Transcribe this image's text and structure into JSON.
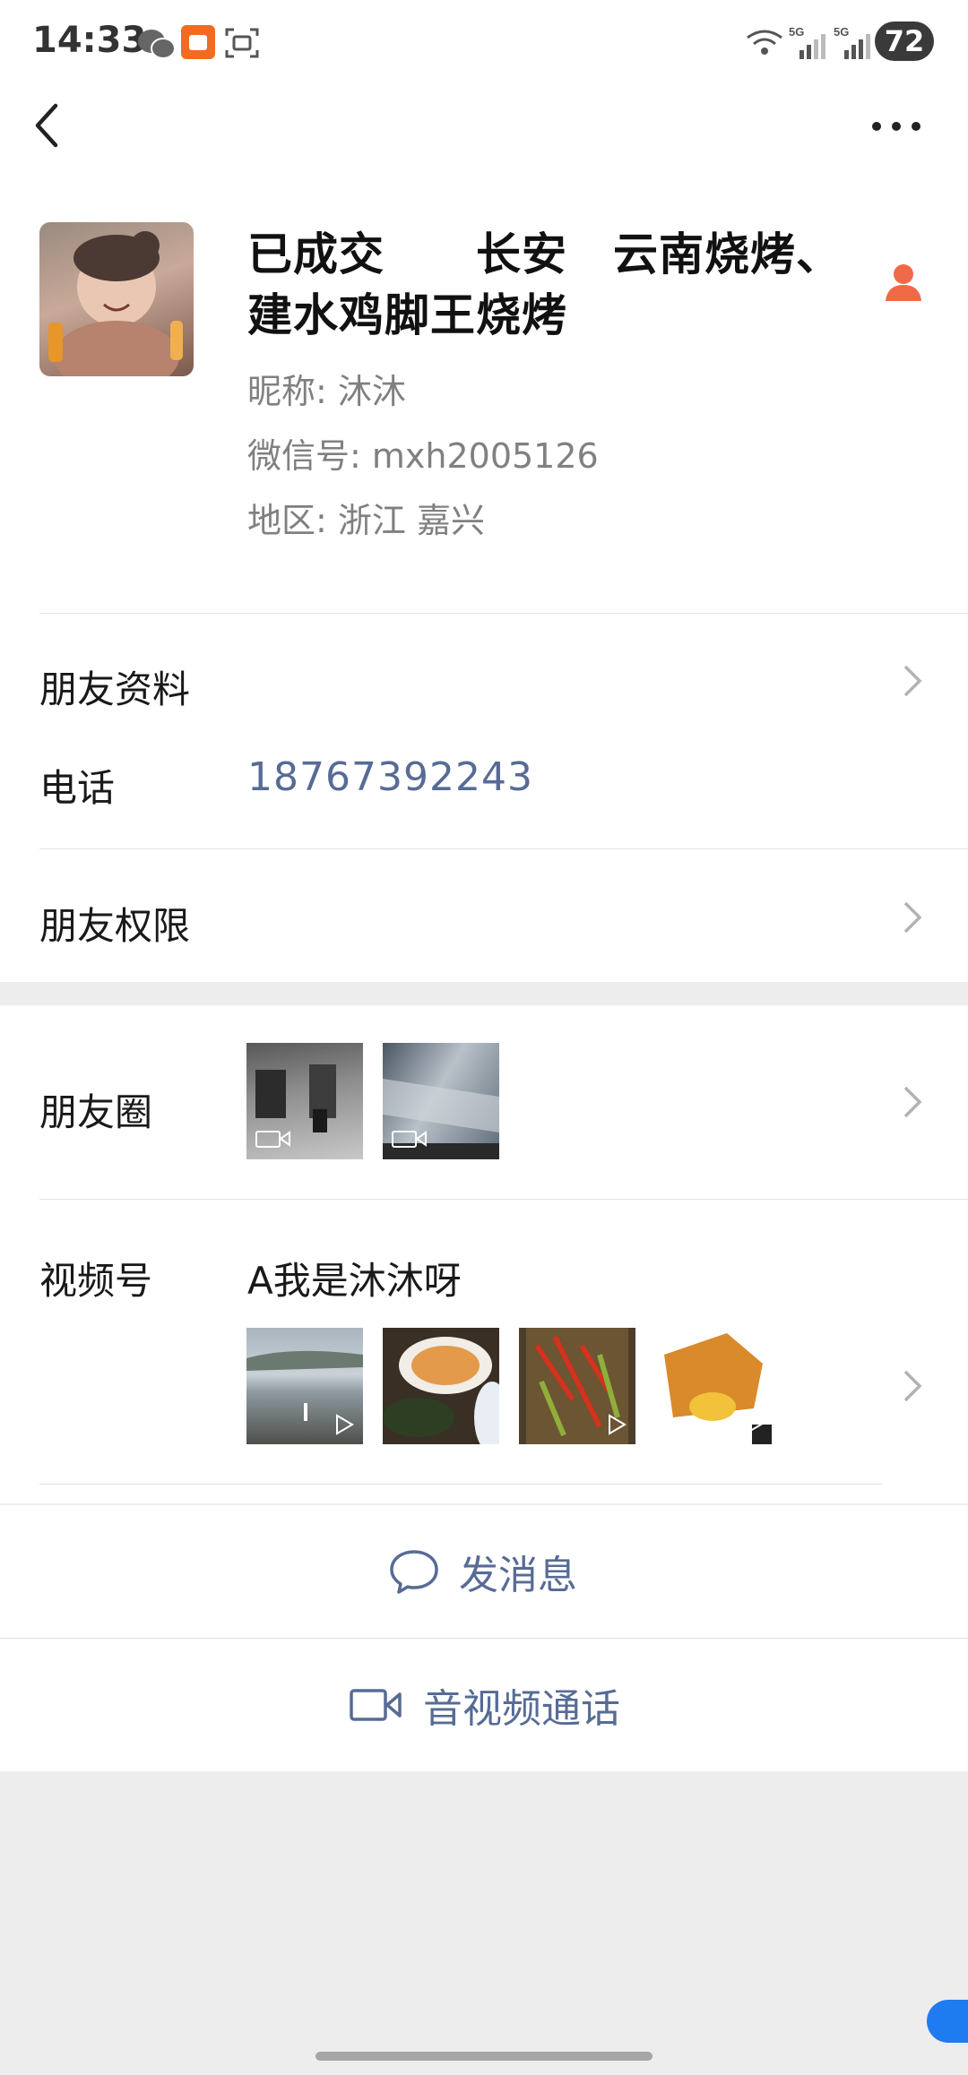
{
  "status_bar": {
    "time": "14:33",
    "battery": "72",
    "network": [
      "5G",
      "5G"
    ]
  },
  "profile": {
    "display_name": "已成交　　长安　云南烧烤、建水鸡脚王烧烤",
    "nickname": "昵称:  沐沐",
    "wechat_id": "微信号:  mxh2005126",
    "region": "地区:  浙江  嘉兴"
  },
  "rows": {
    "friend_info_label": "朋友资料",
    "phone_label": "电话",
    "phone_value": "18767392243",
    "permissions_label": "朋友权限",
    "moments_label": "朋友圈",
    "channels_label": "视频号",
    "channel_name": "A我是沐沐呀"
  },
  "actions": {
    "message": "发消息",
    "call": "音视频通话"
  },
  "icons": {
    "back": "back-arrow-icon",
    "more": "more-dots-icon",
    "chevron": "chevron-right-icon",
    "message": "chat-bubble-icon",
    "video": "video-camera-icon"
  },
  "colors": {
    "link": "#576b95",
    "background": "#ededed",
    "contact_badge": "#f06a4a"
  }
}
